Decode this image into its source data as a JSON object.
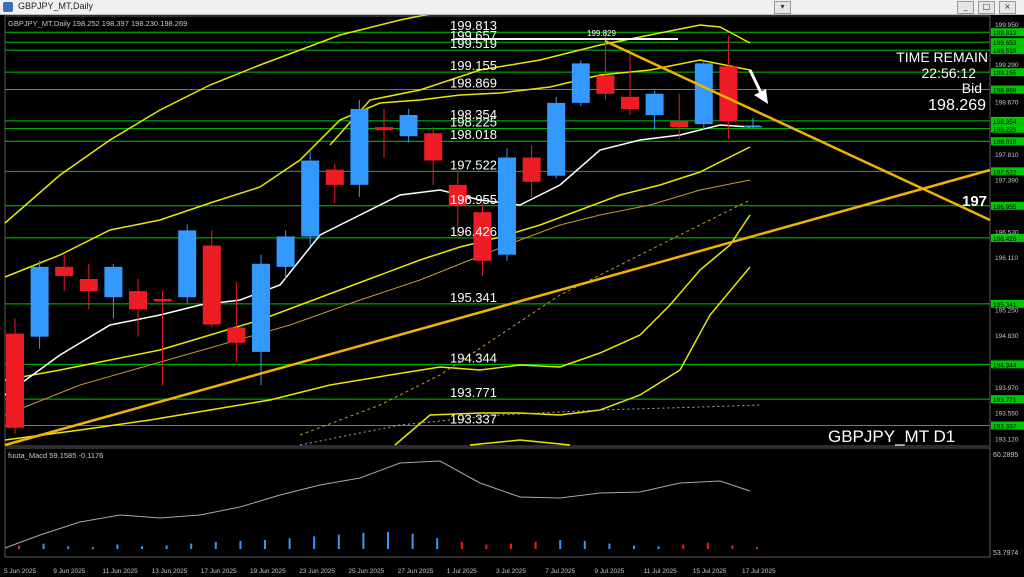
{
  "window": {
    "title": "GBPJPY_MT,Daily",
    "min_label": "_",
    "max_label": "□",
    "close_label": "×",
    "restore_label": "▾"
  },
  "main": {
    "header_text": "GBPJPY_MT,Daily  198.252 198.397 198.230 198.269",
    "symbol_label": "GBPJPY_MT D1",
    "time_remain_label": "TIME REMAIN",
    "time_remain_value": "22:56:12",
    "bid_label": "Bid",
    "bid_value": "198.269",
    "right_cut_label": "197",
    "peak_label": "199.829",
    "levels": [
      {
        "label": "199.813",
        "axis": "199.813",
        "y": 199.813
      },
      {
        "label": "199.657",
        "axis": "199.653",
        "y": 199.65
      },
      {
        "label": "199.519",
        "axis": "199.519",
        "y": 199.519
      },
      {
        "label": "199.155",
        "axis": "199.155",
        "y": 199.155
      },
      {
        "label": "198.869",
        "axis": "198.869",
        "y": 198.869
      },
      {
        "label": "198.354",
        "axis": "198.354",
        "y": 198.354
      },
      {
        "label": "198.225",
        "axis": "198.225",
        "y": 198.225
      },
      {
        "label": "198.018",
        "axis": "198.018",
        "y": 198.018
      },
      {
        "label": "197.522",
        "axis": "197.522",
        "y": 197.522
      },
      {
        "label": "196.955",
        "axis": "196.955",
        "y": 196.955
      },
      {
        "label": "196.426",
        "axis": "196.426",
        "y": 196.426
      },
      {
        "label": "195.341",
        "axis": "195.341",
        "y": 195.341
      },
      {
        "label": "194.344",
        "axis": "194.344",
        "y": 194.344
      },
      {
        "label": "193.771",
        "axis": "193.771",
        "y": 193.771
      },
      {
        "label": "193.337",
        "axis": "193.337",
        "y": 193.337
      }
    ],
    "axis_ticks": [
      {
        "label": "199.950",
        "y": 199.95
      },
      {
        "label": "199.290",
        "y": 199.29
      },
      {
        "label": "198.670",
        "y": 198.67
      },
      {
        "label": "197.810",
        "y": 197.81
      },
      {
        "label": "197.390",
        "y": 197.39
      },
      {
        "label": "196.530",
        "y": 196.53
      },
      {
        "label": "196.110",
        "y": 196.11
      },
      {
        "label": "195.250",
        "y": 195.25
      },
      {
        "label": "194.830",
        "y": 194.83
      },
      {
        "label": "193.970",
        "y": 193.97
      },
      {
        "label": "193.550",
        "y": 193.55
      },
      {
        "label": "193.120",
        "y": 193.12
      }
    ],
    "macd_label": "fuuta_Macd 59.1585  -0.1176",
    "macd_top": "60.2895",
    "macd_bottom": "53.7974",
    "date_labels": [
      "5 Jun 2025",
      "9 Jun 2025",
      "11 Jun 2025",
      "13 Jun 2025",
      "17 Jun 2025",
      "19 Jun 2025",
      "23 Jun 2025",
      "25 Jun 2025",
      "27 Jun 2025",
      "1 Jul 2025",
      "3 Jul 2025",
      "7 Jul 2025",
      "9 Jul 2025",
      "11 Jul 2025",
      "15 Jul 2025",
      "17 Jul 2025"
    ]
  },
  "colors": {
    "bull": "#3399ff",
    "bear": "#ee1c24",
    "levels": "#00c800",
    "trend": "#f0b400",
    "bands": "#e8e800",
    "ma": "#ffffff",
    "axis_text": "#c8c8c8",
    "grid": "#404040"
  },
  "chart_data": {
    "type": "candlestick",
    "symbol": "GBPJPY_MT",
    "timeframe": "Daily",
    "ylim": [
      193.0,
      200.08
    ],
    "candles": [
      {
        "o": 194.85,
        "h": 195.1,
        "l": 193.2,
        "c": 193.3
      },
      {
        "o": 194.8,
        "h": 196.05,
        "l": 194.6,
        "c": 195.95
      },
      {
        "o": 195.95,
        "h": 196.15,
        "l": 195.55,
        "c": 195.8
      },
      {
        "o": 195.75,
        "h": 196.0,
        "l": 195.25,
        "c": 195.55
      },
      {
        "o": 195.45,
        "h": 196.0,
        "l": 195.1,
        "c": 195.95
      },
      {
        "o": 195.55,
        "h": 195.75,
        "l": 194.8,
        "c": 195.25
      },
      {
        "o": 195.42,
        "h": 195.55,
        "l": 194.0,
        "c": 195.38
      },
      {
        "o": 195.45,
        "h": 196.65,
        "l": 195.35,
        "c": 196.55
      },
      {
        "o": 196.3,
        "h": 196.55,
        "l": 194.95,
        "c": 195.0
      },
      {
        "o": 194.95,
        "h": 195.7,
        "l": 194.4,
        "c": 194.7
      },
      {
        "o": 194.55,
        "h": 196.15,
        "l": 194.0,
        "c": 196.0
      },
      {
        "o": 195.95,
        "h": 196.55,
        "l": 195.75,
        "c": 196.45
      },
      {
        "o": 196.45,
        "h": 197.85,
        "l": 196.3,
        "c": 197.7
      },
      {
        "o": 197.55,
        "h": 197.65,
        "l": 197.0,
        "c": 197.3
      },
      {
        "o": 197.3,
        "h": 198.7,
        "l": 197.1,
        "c": 198.55
      },
      {
        "o": 198.25,
        "h": 198.55,
        "l": 197.75,
        "c": 198.2
      },
      {
        "o": 198.1,
        "h": 198.55,
        "l": 198.0,
        "c": 198.45
      },
      {
        "o": 198.15,
        "h": 198.25,
        "l": 197.3,
        "c": 197.7
      },
      {
        "o": 197.3,
        "h": 197.55,
        "l": 196.45,
        "c": 196.95
      },
      {
        "o": 196.85,
        "h": 197.0,
        "l": 195.8,
        "c": 196.05
      },
      {
        "o": 196.15,
        "h": 197.9,
        "l": 196.05,
        "c": 197.75
      },
      {
        "o": 197.75,
        "h": 197.95,
        "l": 197.1,
        "c": 197.35
      },
      {
        "o": 197.45,
        "h": 198.75,
        "l": 197.4,
        "c": 198.65
      },
      {
        "o": 198.65,
        "h": 199.35,
        "l": 198.6,
        "c": 199.3
      },
      {
        "o": 199.1,
        "h": 199.85,
        "l": 198.7,
        "c": 198.8
      },
      {
        "o": 198.75,
        "h": 199.45,
        "l": 198.45,
        "c": 198.55
      },
      {
        "o": 198.45,
        "h": 198.85,
        "l": 198.2,
        "c": 198.8
      },
      {
        "o": 198.35,
        "h": 198.8,
        "l": 198.05,
        "c": 198.25
      },
      {
        "o": 198.3,
        "h": 199.35,
        "l": 198.2,
        "c": 199.3
      },
      {
        "o": 199.25,
        "h": 199.75,
        "l": 198.05,
        "c": 198.35
      },
      {
        "o": 198.25,
        "h": 198.4,
        "l": 198.23,
        "c": 198.27
      }
    ]
  }
}
